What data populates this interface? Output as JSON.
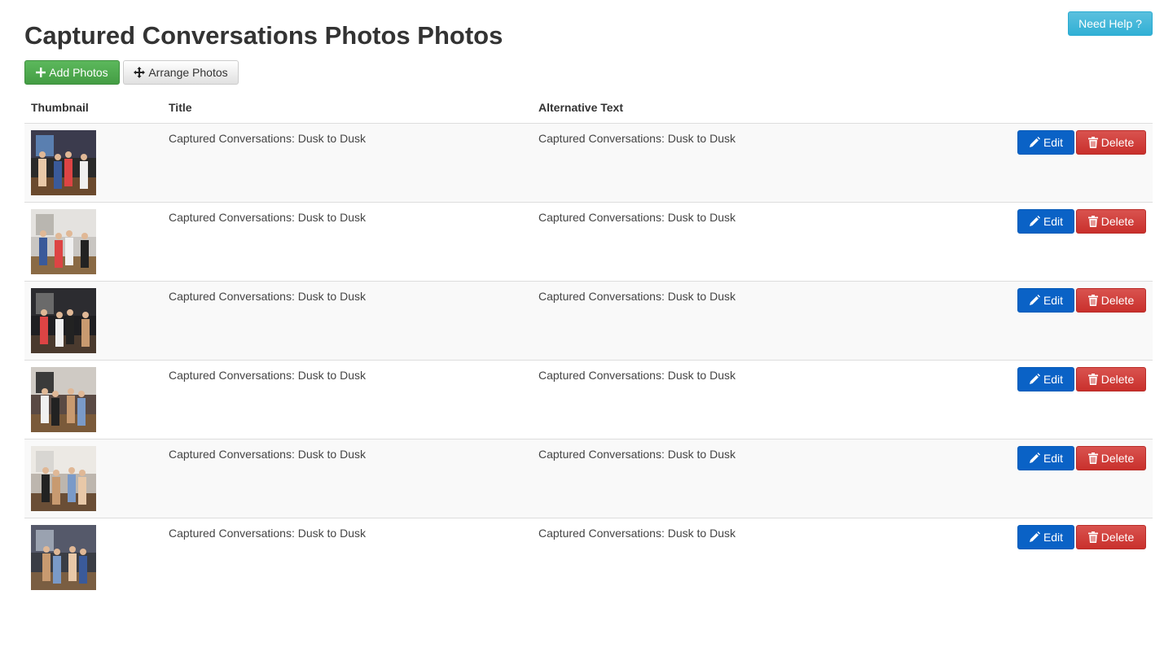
{
  "header": {
    "title": "Captured Conversations Photos Photos",
    "help_label": "Need Help ?"
  },
  "toolbar": {
    "add_label": "Add Photos",
    "arrange_label": "Arrange Photos"
  },
  "table": {
    "columns": [
      "Thumbnail",
      "Title",
      "Alternative Text"
    ],
    "rows": [
      {
        "title": "Captured Conversations: Dusk to Dusk",
        "alt": "Captured Conversations: Dusk to Dusk",
        "edit": "Edit",
        "delete": "Delete"
      },
      {
        "title": "Captured Conversations: Dusk to Dusk",
        "alt": "Captured Conversations: Dusk to Dusk",
        "edit": "Edit",
        "delete": "Delete"
      },
      {
        "title": "Captured Conversations: Dusk to Dusk",
        "alt": "Captured Conversations: Dusk to Dusk",
        "edit": "Edit",
        "delete": "Delete"
      },
      {
        "title": "Captured Conversations: Dusk to Dusk",
        "alt": "Captured Conversations: Dusk to Dusk",
        "edit": "Edit",
        "delete": "Delete"
      },
      {
        "title": "Captured Conversations: Dusk to Dusk",
        "alt": "Captured Conversations: Dusk to Dusk",
        "edit": "Edit",
        "delete": "Delete"
      },
      {
        "title": "Captured Conversations: Dusk to Dusk",
        "alt": "Captured Conversations: Dusk to Dusk",
        "edit": "Edit",
        "delete": "Delete"
      }
    ]
  },
  "icons": {
    "add": "plus-icon",
    "arrange": "move-arrows-icon",
    "edit": "pencil-icon",
    "delete": "trash-icon"
  },
  "colors": {
    "help": "#31b0d5",
    "add": "#4cae4c",
    "edit": "#0a62c6",
    "delete": "#d9534f"
  }
}
